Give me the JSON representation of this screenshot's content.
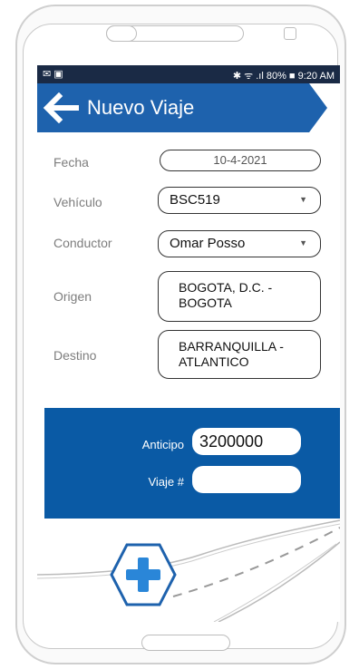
{
  "status": {
    "left_icons": "✉ ▣",
    "right": "✱ ᯤ .ıl 80% ■ 9:20 AM"
  },
  "header": {
    "title": "Nuevo Viaje"
  },
  "form": {
    "fecha_label": "Fecha",
    "fecha_value": "10-4-2021",
    "vehiculo_label": "Vehículo",
    "vehiculo_value": "BSC519",
    "conductor_label": "Conductor",
    "conductor_value": "Omar Posso",
    "origen_label": "Origen",
    "origen_line1": "BOGOTA, D.C. -",
    "origen_line2": "BOGOTA",
    "destino_label": "Destino",
    "destino_line1": "BARRANQUILLA -",
    "destino_line2": "ATLANTICO"
  },
  "panel": {
    "anticipo_label": "Anticipo",
    "anticipo_value": "3200000",
    "viaje_label": "Viaje #",
    "viaje_value": ""
  },
  "colors": {
    "accent": "#1e62ad",
    "panel": "#0a5aa5",
    "statusbar": "#1a2a45"
  },
  "icons": [
    "back-arrow-icon",
    "dropdown-caret-icon",
    "add-hexagon-icon"
  ]
}
